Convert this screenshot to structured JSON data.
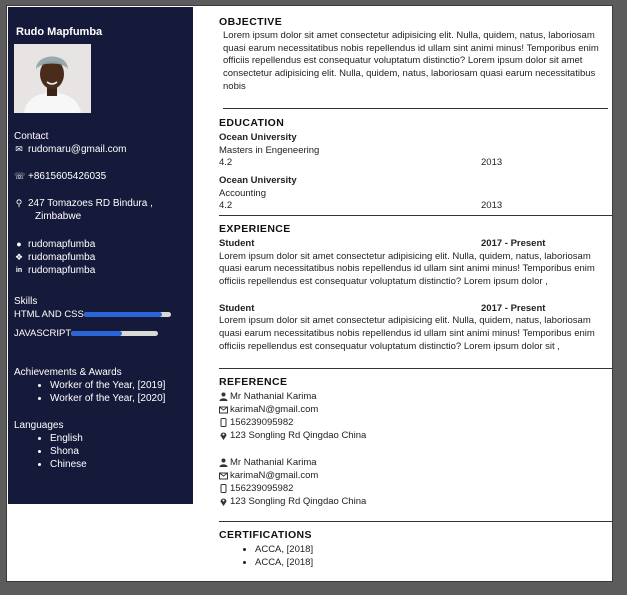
{
  "profile": {
    "name": "Rudo Mapfumba"
  },
  "contact": {
    "heading": "Contact",
    "email": "rudomaru@gmail.com",
    "phone": "+8615605426035",
    "address_line1": "247 Tomazoes RD Bindura ,",
    "address_line2": "Zimbabwe"
  },
  "social": [
    {
      "icon": "github-icon",
      "handle": "rudomapfumba"
    },
    {
      "icon": "twitter-icon",
      "handle": "rudomapfumba"
    },
    {
      "icon": "linkedin-icon",
      "handle": "rudomapfumba"
    }
  ],
  "skills": {
    "heading": "Skills",
    "items": [
      {
        "label": "HTML AND CSS",
        "level": 0.9
      },
      {
        "label": "JAVASCRIPT",
        "level": 0.58
      }
    ]
  },
  "achievements": {
    "heading": "Achievements & Awards",
    "items": [
      "Worker of the Year, [2019]",
      "Worker of the Year, [2020]"
    ]
  },
  "languages": {
    "heading": "Languages",
    "items": [
      "English",
      "Shona",
      "Chinese"
    ]
  },
  "objective": {
    "heading": "OBJECTIVE",
    "text": "Lorem ipsum dolor sit amet consectetur adipisicing elit. Nulla, quidem, natus, laboriosam quasi earum necessitatibus nobis repellendus id ullam sint animi minus! Temporibus enim officiis repellendus est consequatur voluptatum distinctio? Lorem ipsum dolor sit amet consectetur adipisicing elit. Nulla, quidem, natus, laboriosam quasi earum necessitatibus nobis"
  },
  "education": {
    "heading": "EDUCATION",
    "items": [
      {
        "school": "Ocean University",
        "degree": "Masters in Engeneering",
        "grade": "4.2",
        "year": "2013"
      },
      {
        "school": "Ocean University",
        "degree": "Accounting",
        "grade": "4.2",
        "year": "2013"
      }
    ]
  },
  "experience": {
    "heading": "EXPERIENCE",
    "items": [
      {
        "role": "Student",
        "period": "2017 - Present",
        "text": "Lorem ipsum dolor sit amet consectetur adipisicing elit. Nulla, quidem, natus, laboriosam quasi earum necessitatibus nobis repellendus id ullam sint animi minus! Temporibus enim officiis repellendus est consequatur voluptatum distinctio? Lorem ipsum dolor ,"
      },
      {
        "role": "Student",
        "period": "2017 - Present",
        "text": "Lorem ipsum dolor sit amet consectetur adipisicing elit. Nulla, quidem, natus, laboriosam quasi earum necessitatibus nobis repellendus id ullam sint animi minus! Temporibus enim officiis repellendus est consequatur voluptatum distinctio? Lorem ipsum dolor sit ,"
      }
    ]
  },
  "reference": {
    "heading": "REFERENCE",
    "items": [
      {
        "name": "Mr Nathanial Karima",
        "email": "karimaN@gmail.com",
        "phone": "156239095982",
        "address": "123 Songling Rd Qingdao China"
      },
      {
        "name": "Mr Nathanial Karima",
        "email": "karimaN@gmail.com",
        "phone": "156239095982",
        "address": "123 Songling Rd Qingdao China"
      }
    ]
  },
  "certifications": {
    "heading": "CERTIFICATIONS",
    "items": [
      "ACCA, [2018]",
      "ACCA, [2018]"
    ]
  },
  "colors": {
    "sidebar": "#161a3a",
    "skill_bar": "#2a64d6",
    "skill_track": "#d9d9d9"
  }
}
